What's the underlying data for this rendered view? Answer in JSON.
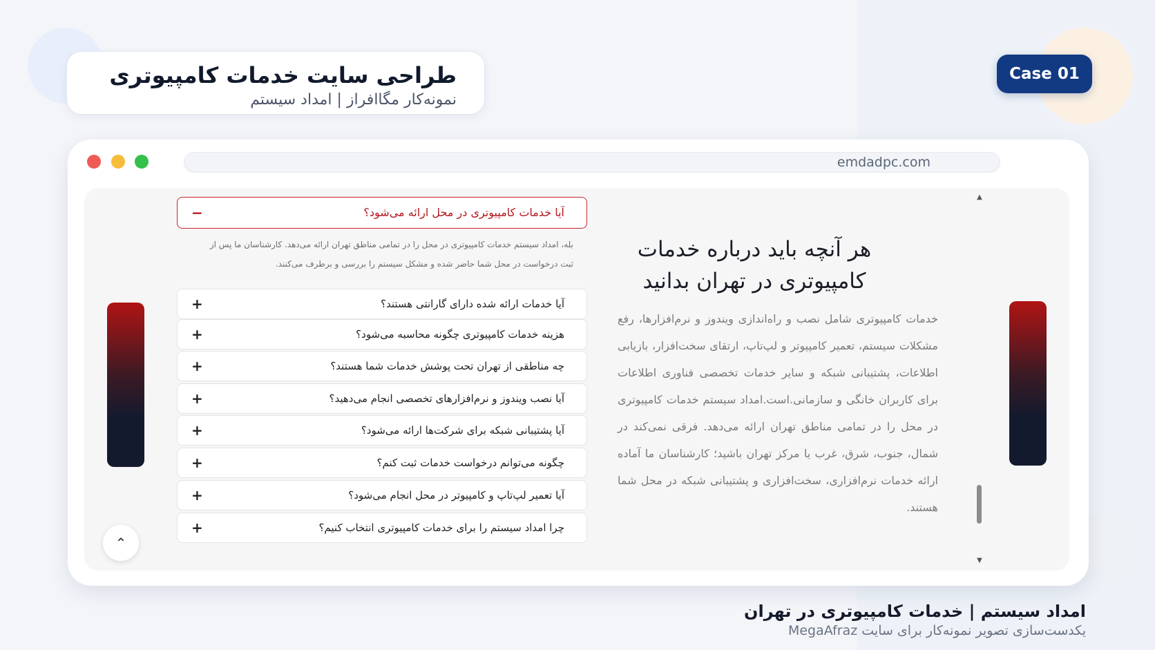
{
  "header": {
    "title": "طراحی سایت خدمات کامپیوتری",
    "subtitle": "نمونه‌کار مگاافراز | امداد سیستم"
  },
  "badge": {
    "label": "Case 01",
    "color": "#123a82"
  },
  "browser": {
    "url": "emdadpc.com",
    "window_controls": [
      "close-dot",
      "minimize-dot",
      "maximize-dot"
    ]
  },
  "faq": {
    "open_item": {
      "question": "آیا خدمات کامپیوتری در محل ارائه می‌شود؟",
      "toggle": "−",
      "answer_line1": "بله، امداد سیستم خدمات کامپیوتری در محل را در تمامی مناطق تهران ارائه می‌دهد. کارشناسان ما پس از",
      "answer_line2": "ثبت درخواست در محل شما حاضر شده و مشکل سیستم را بررسی و برطرف می‌کنند."
    },
    "items": [
      {
        "question": "آیا خدمات ارائه شده دارای گارانتی هستند؟",
        "toggle": "+"
      },
      {
        "question": "هزینه خدمات کامپیوتری چگونه محاسبه می‌شود؟",
        "toggle": "+"
      },
      {
        "question": "چه مناطقی از تهران تحت پوشش خدمات شما هستند؟",
        "toggle": "+"
      },
      {
        "question": "آیا نصب ویندوز و نرم‌افزارهای تخصصی انجام می‌دهید؟",
        "toggle": "+"
      },
      {
        "question": "آیا پشتیبانی شبکه برای شرکت‌ها ارائه می‌شود؟",
        "toggle": "+"
      },
      {
        "question": "چگونه می‌توانم درخواست خدمات ثبت کنم؟",
        "toggle": "+"
      },
      {
        "question": "آیا تعمیر لپ‌تاپ و کامپیوتر در محل انجام می‌شود؟",
        "toggle": "+"
      },
      {
        "question": "چرا امداد سیستم را برای خدمات کامپیوتری انتخاب کنیم؟",
        "toggle": "+"
      }
    ]
  },
  "about": {
    "title_line1": "هر آنچه باید درباره خدمات",
    "title_line2": "کامپیوتری در تهران بدانید",
    "body": "خدمات کامپیوتری شامل نصب و راه‌اندازی ویندوز و نرم‌افزارها، رفع مشکلات سیستم، تعمیر کامپیوتر و لپ‌تاپ، ارتقای سخت‌افزار، بازیابی اطلاعات، پشتیبانی شبکه و سایر خدمات تخصصی فناوری اطلاعات برای کاربران خانگی و سازمانی.است.امداد سیستم خدمات کامپیوتری در محل را در تمامی مناطق تهران ارائه می‌دهد. فرقی نمی‌کند در شمال، جنوب، شرق، غرب یا مرکز تهران باشید؛ کارشناسان ما آماده ارائه خدمات نرم‌افزاری، سخت‌افزاری و پشتیبانی شبکه در محل شما هستند."
  },
  "controls": {
    "scroll_top_icon": "chevron-up-icon",
    "scroll_top_glyph": "⌃",
    "scrollbar_up": "▲",
    "scrollbar_down": "▼"
  },
  "footer": {
    "title": "امداد سیستم | خدمات کامپیوتری در تهران",
    "subtitle": "یکدست‌سازی تصویر نمونه‌کار برای سایت MegaAfraz"
  },
  "colors": {
    "accent_red": "#c9252b",
    "brand_navy": "#123a82",
    "dark_navy": "#141a2e"
  }
}
